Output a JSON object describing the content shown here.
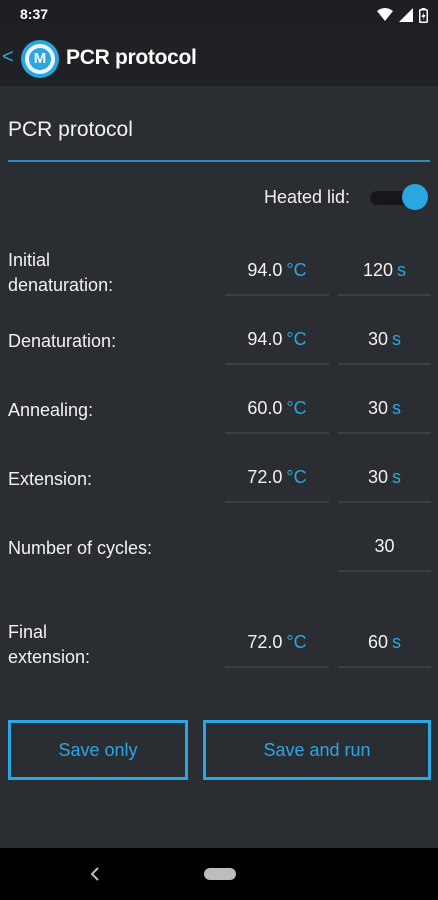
{
  "status_bar": {
    "time": "8:37",
    "icons": [
      "wifi-icon",
      "signal-icon",
      "battery-icon"
    ]
  },
  "app_bar": {
    "back_glyph": "<",
    "logo_letter": "M",
    "title": "PCR protocol"
  },
  "protocol_name": {
    "value": "PCR protocol"
  },
  "heated_lid": {
    "label": "Heated lid:",
    "enabled": true
  },
  "steps": {
    "initial_denaturation": {
      "label_line1": "Initial",
      "label_line2": "denaturation:",
      "temp": "94.0",
      "temp_unit": "°C",
      "time": "120",
      "time_unit": "s"
    },
    "denaturation": {
      "label": "Denaturation:",
      "temp": "94.0",
      "temp_unit": "°C",
      "time": "30",
      "time_unit": "s"
    },
    "annealing": {
      "label": "Annealing:",
      "temp": "60.0",
      "temp_unit": "°C",
      "time": "30",
      "time_unit": "s"
    },
    "extension": {
      "label": "Extension:",
      "temp": "72.0",
      "temp_unit": "°C",
      "time": "30",
      "time_unit": "s"
    },
    "cycles": {
      "label": "Number of cycles:",
      "value": "30"
    },
    "final_extension": {
      "label_line1": "Final",
      "label_line2": "extension:",
      "temp": "72.0",
      "temp_unit": "°C",
      "time": "60",
      "time_unit": "s"
    }
  },
  "buttons": {
    "save_only": "Save only",
    "save_and_run": "Save and run"
  },
  "colors": {
    "accent": "#2aa6e3",
    "background": "#2a2d31",
    "app_bar": "#1f2124"
  }
}
